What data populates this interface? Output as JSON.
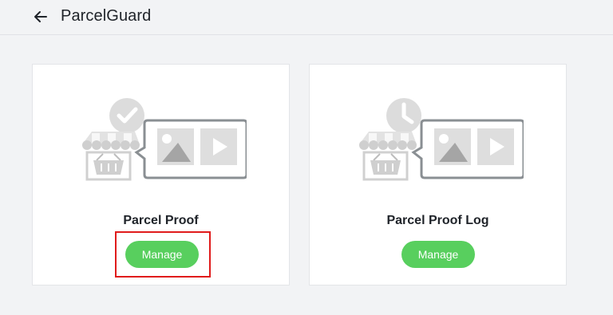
{
  "header": {
    "back_icon": "arrow-left-icon",
    "title": "ParcelGuard"
  },
  "cards": [
    {
      "title": "Parcel Proof",
      "button_label": "Manage",
      "illustration_badge": "checkmark-icon"
    },
    {
      "title": "Parcel Proof Log",
      "button_label": "Manage",
      "illustration_badge": "clock-icon"
    }
  ],
  "colors": {
    "accent_button": "#58cf5e",
    "highlight_border": "#e01b1b",
    "illustration_gray": "#d8d8d8"
  }
}
